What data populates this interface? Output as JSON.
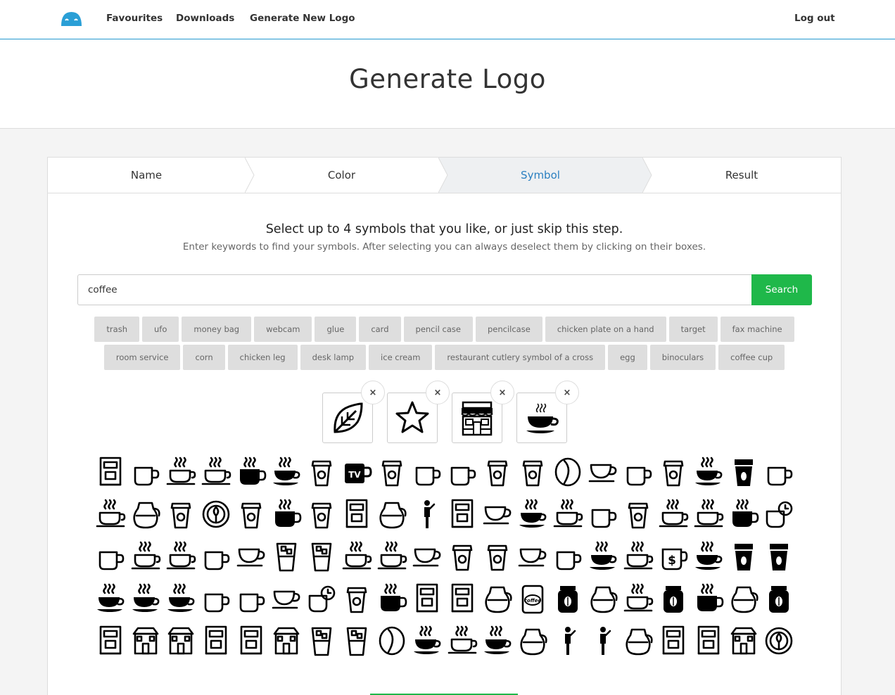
{
  "nav": {
    "favourites": "Favourites",
    "downloads": "Downloads",
    "generate": "Generate New Logo",
    "logout": "Log out"
  },
  "page": {
    "title": "Generate Logo"
  },
  "steps": [
    "Name",
    "Color",
    "Symbol",
    "Result"
  ],
  "symbol_step": {
    "lead": "Select up to 4 symbols that you like, or just skip this step.",
    "sub": "Enter keywords to find your symbols. After selecting you can always deselect them by clicking on their boxes.",
    "search_value": "coffee",
    "search_button": "Search",
    "tags_row1": [
      "trash",
      "ufo",
      "money bag",
      "webcam",
      "glue",
      "card",
      "pencil case",
      "pencilcase",
      "chicken plate on a hand",
      "target",
      "fax machine"
    ],
    "tags_row2": [
      "room service",
      "corn",
      "chicken leg",
      "desk lamp",
      "ice cream",
      "restaurant cutlery symbol of a cross",
      "egg",
      "binoculars",
      "coffee cup"
    ],
    "selected_icons": [
      "leaf-icon",
      "star-icon",
      "shop-icon",
      "coffee-cup-icon"
    ],
    "remove_glyph": "×",
    "tv_text": "TV",
    "dollar_text": "$",
    "coffee_label": "coffee",
    "grid_icons": [
      [
        "coffee-machine-icon",
        "coffee-tray-icon",
        "coffee-flower-icon",
        "coffee-saucer-icon",
        "coffee-mug-filled-icon",
        "coffee-cup-filled-icon",
        "takeaway-cup-icon",
        "tv-mug-icon",
        "takeaway-lid-icon",
        "hot-mug-icon",
        "espresso-mug-icon",
        "two-cups-icon",
        "takeaway-bean-icon",
        "coffee-bean-outline-icon",
        "teacup-icon",
        "cappuccino-icon",
        "takeaway-square-icon",
        "hot-cup-filled-icon",
        "takeaway-stripe-icon",
        "glass-mug-icon"
      ],
      [
        "tea-set-icon",
        "moka-pot-icon",
        "cups-stack-icon",
        "latte-bowl-icon",
        "paper-cup-icon",
        "coffee-sleeve-icon",
        "takeaway-dots-icon",
        "espresso-machine-icon",
        "kettle-icon",
        "barista-icon",
        "cup-box-icon",
        "simple-cup-icon",
        "steaming-cup-filled-icon",
        "steaming-cup-icon",
        "mug-outline-icon",
        "takeaway-circle-icon",
        "coffee-layers-icon",
        "cup-saucer-icon",
        "hot-coffee-filled-icon",
        "coffee-clock-icon"
      ],
      [
        "big-mug-icon",
        "foam-cup-icon",
        "steam-cup-icon",
        "glass-cup-icon",
        "martini-cup-icon",
        "drip-cup-icon",
        "irish-coffee-icon",
        "bean-cup-icon",
        "cup-outline-icon",
        "simple-teacup-icon",
        "takeaway-a-icon",
        "takeaway-b-icon",
        "small-cup-icon",
        "large-mug-icon",
        "cup-saucer-filled-icon",
        "cup-steam-outline-icon",
        "dollar-cup-icon",
        "coffee-filled-small-icon",
        "takeaway-filled-icon",
        "takeaway-bean-filled-icon"
      ],
      [
        "coffee-cup-bold-icon",
        "bowl-cup-icon",
        "coffee-saucer-bold-icon",
        "mug-bold-icon",
        "thermos-mug-icon",
        "steam-bowl-icon",
        "clock-cup-icon",
        "bean-takeaway-icon",
        "mug-wide-icon",
        "portafilter-icon",
        "espresso-stand-icon",
        "coffee-pot-icon",
        "coffee-tin-icon",
        "coffee-bag-icon",
        "coffee-carafe-icon",
        "cup-steam-icon",
        "milk-carton-icon",
        "coffee-mug-steam-icon",
        "coffee-maker-icon",
        "coffee-jar-icon"
      ],
      [
        "french-press-icon",
        "coffee-speech-icon",
        "coffee-shop-icon",
        "coffee-grinder-icon",
        "vending-machine-icon",
        "cafe-storefront-icon",
        "iced-coffee-icon",
        "frappe-cup-icon",
        "coffee-bean-large-icon",
        "coffee-cup-plate-icon",
        "coffee-cup-outline-icon",
        "saucer-cup-icon",
        "moka-stove-icon",
        "desk-worker-icon",
        "person-drinking-icon",
        "chemex-icon",
        "coffee-counter-icon",
        "coffee-jar-machine-icon",
        "espresso-bar-icon",
        "latte-art-icon"
      ]
    ]
  }
}
